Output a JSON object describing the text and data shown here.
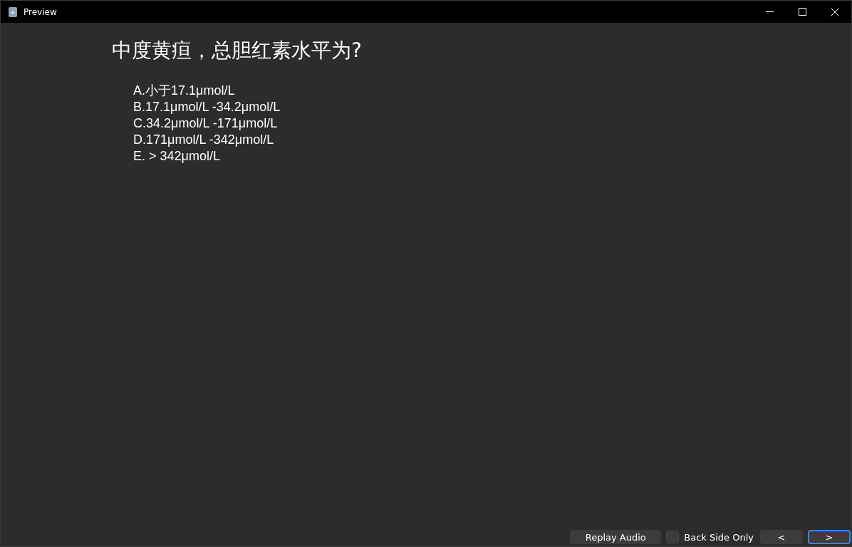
{
  "window": {
    "title": "Preview"
  },
  "question": "中度黄疸，总胆红素水平为?",
  "options": [
    "A.小于17.1μmol/L",
    "B.17.1μmol/L -34.2μmol/L",
    "C.34.2μmol/L -171μmol/L",
    "D.171μmol/L -342μmol/L",
    "E. > 342μmol/L"
  ],
  "controls": [
    {
      "kind": "button",
      "label": "Replay Audio",
      "focused": false
    },
    {
      "kind": "checkbox",
      "label": "Back Side Only",
      "checked": false
    },
    {
      "kind": "nav",
      "label": "<",
      "focused": false
    },
    {
      "kind": "nav",
      "label": ">",
      "focused": true
    }
  ]
}
